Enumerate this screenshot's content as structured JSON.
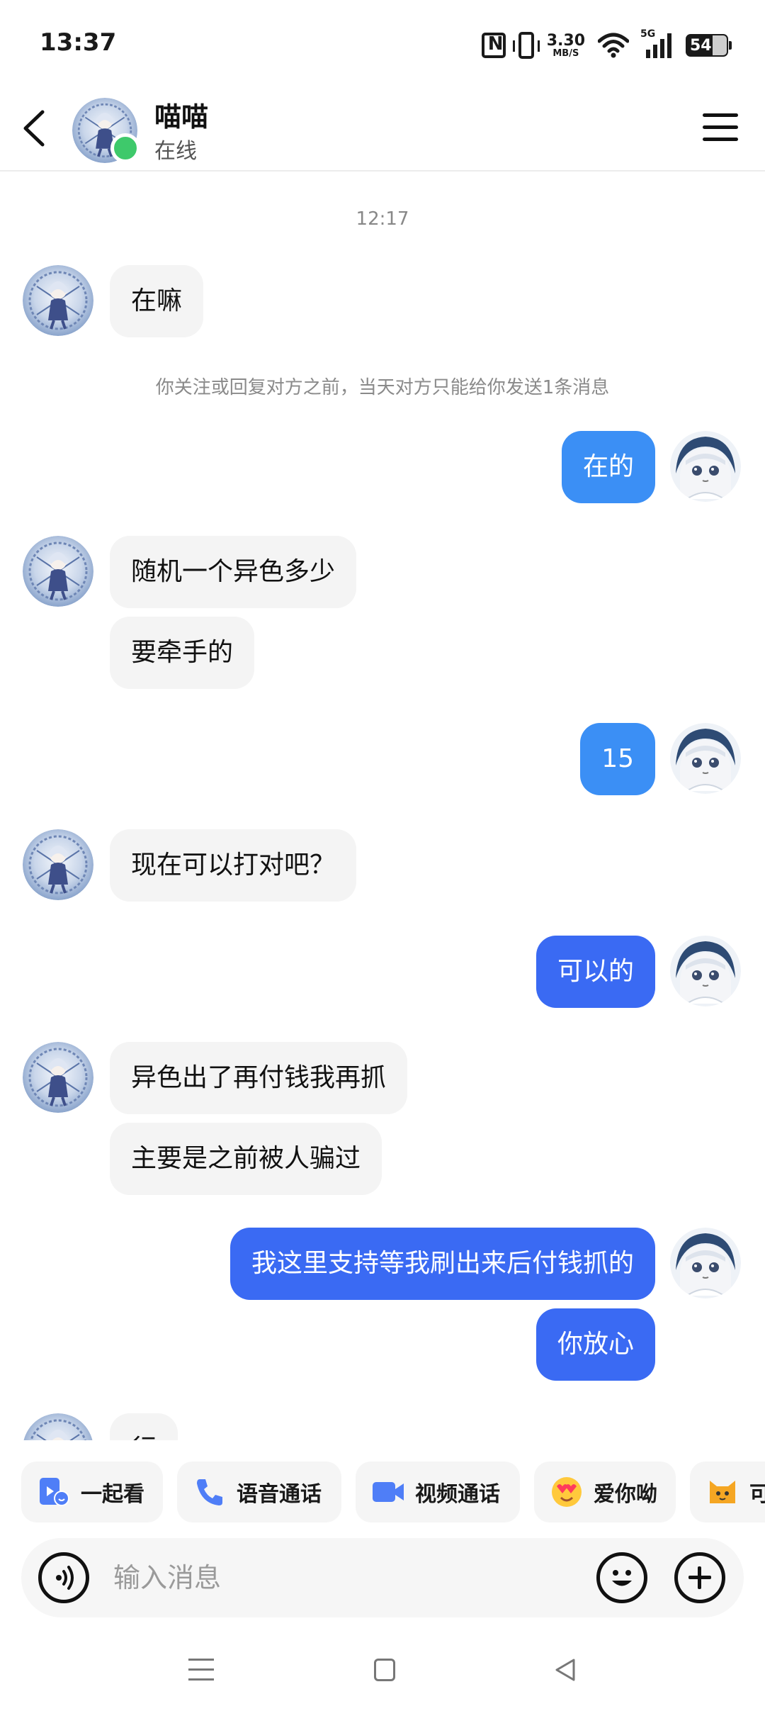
{
  "status_bar": {
    "time": "13:37",
    "net_speed_value": "3.30",
    "net_speed_unit": "MB/S",
    "signal_label": "5G",
    "battery": "54",
    "icons": [
      "nfc-icon",
      "vibrate-icon",
      "wifi-icon",
      "signal-icon",
      "battery-icon"
    ]
  },
  "header": {
    "name": "喵喵",
    "status": "在线",
    "icons": [
      "back-icon",
      "menu-icon"
    ],
    "online_color": "#3ec96b"
  },
  "chat": {
    "time_divider": "12:17",
    "notice": "你关注或回复对方之前，当天对方只能给你发送1条消息",
    "messages": [
      {
        "side": "in",
        "text": "在嘛"
      },
      {
        "side": "out",
        "text": "在的"
      },
      {
        "side": "in",
        "text": "随机一个异色多少"
      },
      {
        "side": "in",
        "text": "要牵手的"
      },
      {
        "side": "out",
        "text": "15"
      },
      {
        "side": "in",
        "text": "现在可以打对吧？"
      },
      {
        "side": "out",
        "text": "可以的"
      },
      {
        "side": "in",
        "text": "异色出了再付钱我再抓"
      },
      {
        "side": "in",
        "text": "主要是之前被人骗过"
      },
      {
        "side": "out",
        "text": "我这里支持等我刷出来后付钱抓的"
      },
      {
        "side": "out",
        "text": "你放心"
      },
      {
        "side": "in",
        "text": "行"
      }
    ],
    "colors": {
      "incoming": "#f4f4f4",
      "outgoing": "#3b8ff5",
      "outgoing_deep": "#3a6af3"
    }
  },
  "quick_actions": [
    {
      "label": "一起看",
      "icon": "watch-together-icon"
    },
    {
      "label": "语音通话",
      "icon": "phone-icon"
    },
    {
      "label": "视频通话",
      "icon": "video-icon"
    },
    {
      "label": "爱你呦",
      "icon": "love-emoji-icon"
    },
    {
      "label": "可",
      "icon": "cat-emoji-icon"
    }
  ],
  "input": {
    "placeholder": "输入消息",
    "value": "",
    "icons": [
      "voice-icon",
      "emoji-icon",
      "plus-icon"
    ]
  },
  "nav": {
    "icons": [
      "recents-icon",
      "home-icon",
      "back-nav-icon"
    ]
  }
}
